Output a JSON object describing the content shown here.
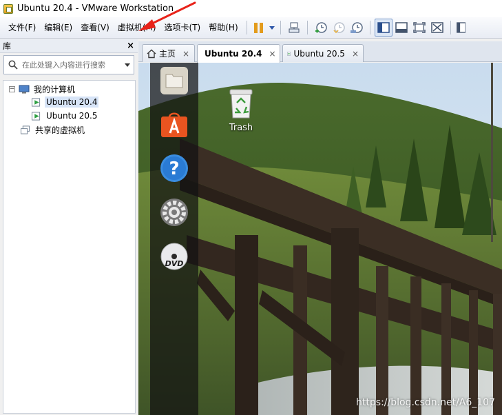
{
  "window": {
    "title": "Ubuntu 20.4 - VMware Workstation"
  },
  "menu": {
    "items": [
      {
        "label": "文件(F)"
      },
      {
        "label": "编辑(E)"
      },
      {
        "label": "查看(V)"
      },
      {
        "label": "虚拟机(M)"
      },
      {
        "label": "选项卡(T)"
      },
      {
        "label": "帮助(H)"
      }
    ]
  },
  "toolbar": {
    "icons": [
      "pause-icon",
      "dropdown-caret-icon",
      "send-keys-icon",
      "snapshot-take-icon",
      "snapshot-revert-icon",
      "snapshot-manager-icon",
      "sidebar-view-icon",
      "console-view-icon",
      "fullscreen-icon",
      "unity-icon",
      "library-icon"
    ]
  },
  "library": {
    "title": "库",
    "close_label": "×",
    "search_placeholder": "在此处键入内容进行搜索",
    "tree": {
      "root_toggle": "−",
      "root_label": "我的计算机",
      "vms": [
        {
          "label": "Ubuntu 20.4"
        },
        {
          "label": "Ubuntu 20.5"
        }
      ],
      "shared_label": "共享的虚拟机"
    }
  },
  "tabs": [
    {
      "label": "主页",
      "close": "×"
    },
    {
      "label": "Ubuntu 20.4",
      "close": "×"
    },
    {
      "label": "Ubuntu 20.5",
      "close": "×"
    }
  ],
  "guest": {
    "dock_icons": [
      "files-icon",
      "software-store-icon",
      "help-icon",
      "settings-icon",
      "dvd-icon"
    ],
    "desktop_trash_label": "Trash",
    "watermark": "https://blog.csdn.net/A6_107"
  },
  "colors": {
    "accent_orange": "#e39b1c",
    "annotation_red": "#e8231a",
    "selection_blue": "#d7e4f7"
  }
}
